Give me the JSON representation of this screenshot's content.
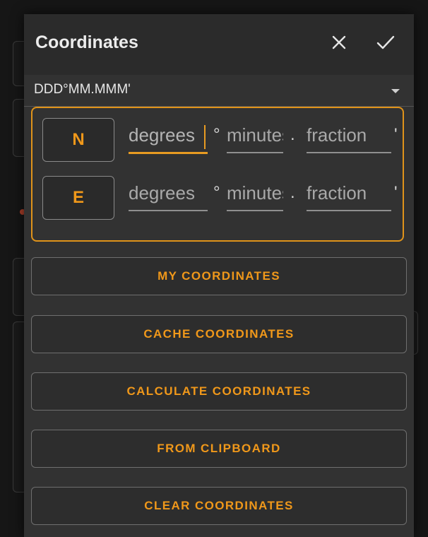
{
  "dialog": {
    "title": "Coordinates",
    "close_icon": "close-icon",
    "confirm_icon": "check-icon"
  },
  "format": {
    "selected": "DDD°MM.MMM'",
    "icon": "dropdown-caret-icon"
  },
  "latitude": {
    "direction": "N",
    "degrees_placeholder": "degrees",
    "degree_symbol": "°",
    "minutes_placeholder": "minutes",
    "decimal_point": ".",
    "fraction_placeholder": "fraction",
    "minute_symbol": "'"
  },
  "longitude": {
    "direction": "E",
    "degrees_placeholder": "degrees",
    "degree_symbol": "°",
    "minutes_placeholder": "minutes",
    "decimal_point": ".",
    "fraction_placeholder": "fraction",
    "minute_symbol": "'"
  },
  "actions": [
    {
      "label": "MY COORDINATES"
    },
    {
      "label": "CACHE COORDINATES"
    },
    {
      "label": "CALCULATE COORDINATES"
    },
    {
      "label": "FROM CLIPBOARD"
    },
    {
      "label": "CLEAR COORDINATES"
    }
  ],
  "colors": {
    "accent": "#e0931a",
    "surface": "#323232",
    "header": "#2b2b2b"
  }
}
